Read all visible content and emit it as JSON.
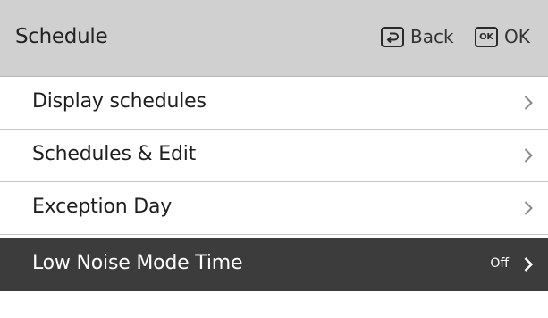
{
  "header": {
    "title": "Schedule",
    "back_label": "Back",
    "ok_label": "OK",
    "ok_key_glyph": "OK"
  },
  "menu": {
    "items": [
      {
        "label": "Display schedules",
        "value": "",
        "selected": false
      },
      {
        "label": "Schedules & Edit",
        "value": "",
        "selected": false
      },
      {
        "label": "Exception Day",
        "value": "",
        "selected": false
      },
      {
        "label": "Low Noise Mode Time",
        "value": "Off",
        "selected": true
      }
    ]
  },
  "colors": {
    "header_bg": "#d0d0d0",
    "selected_bg": "#3c3c3c",
    "text": "#1e1e1e",
    "divider": "#c8c8c8",
    "chevron": "#8a8a8a"
  },
  "icons": {
    "back_key": "back-arrow-icon",
    "ok_key": "ok-key-icon",
    "row_arrow": "chevron-right-icon"
  }
}
